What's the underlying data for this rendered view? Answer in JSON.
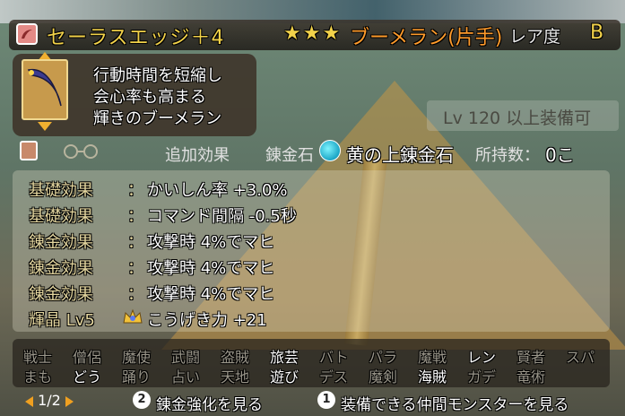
{
  "item": {
    "name": "セーラスエッジ＋4",
    "stars": "★★★",
    "weapon_type": "ブーメラン(片手)",
    "rarity_label": "レア度",
    "rarity_value": "B",
    "description": [
      "行動時間を短縮し",
      "会心率も高まる",
      "輝きのブーメラン"
    ],
    "requirement": "Lv 120 以上装備可"
  },
  "subheader": {
    "extra_effect_label": "追加効果",
    "alchemy_stone_label": "錬金石",
    "alchemy_stone_name": "黄の上錬金石",
    "owned_label": "所持数：",
    "owned_value": "0こ"
  },
  "effects": [
    {
      "label": "基礎効果",
      "value": "かいしん率 +3.0%"
    },
    {
      "label": "基礎効果",
      "value": "コマンド間隔 -0.5秒"
    },
    {
      "label": "錬金効果",
      "value": "攻撃時 4%でマヒ"
    },
    {
      "label": "錬金効果",
      "value": "攻撃時 4%でマヒ"
    },
    {
      "label": "錬金効果",
      "value": "攻撃時 4%でマヒ"
    },
    {
      "label": "輝晶 Lv5",
      "value": "こうげき力 +21"
    }
  ],
  "jobs_row1": [
    "戦士",
    "僧侶",
    "魔使",
    "武闘",
    "盗賊",
    "旅芸",
    "バト",
    "パラ",
    "魔戦",
    "レン",
    "賢者",
    "スパ"
  ],
  "jobs_row1_enabled": [
    false,
    false,
    false,
    false,
    false,
    true,
    false,
    false,
    false,
    true,
    false,
    false
  ],
  "jobs_row2": [
    "まも",
    "どう",
    "踊り",
    "占い",
    "天地",
    "遊び",
    "デス",
    "魔剣",
    "海賊",
    "ガデ",
    "竜術"
  ],
  "jobs_row2_enabled": [
    false,
    true,
    false,
    false,
    false,
    true,
    false,
    false,
    true,
    false,
    false
  ],
  "footer": {
    "page": "1/2",
    "btn2_number": "2",
    "btn2_label": "錬金強化を見る",
    "btn1_number": "1",
    "btn1_label": "装備できる仲間モンスターを見る"
  }
}
